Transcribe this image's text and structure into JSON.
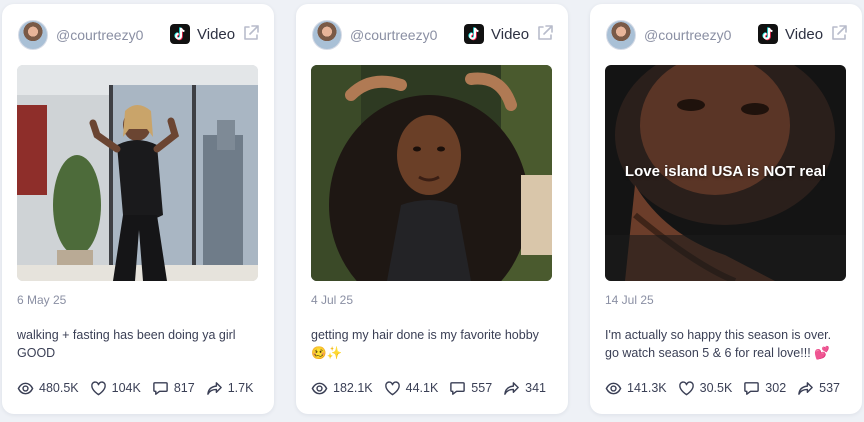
{
  "posts": [
    {
      "username": "@courtreezy0",
      "platform_label": "Video",
      "date": "6 May 25",
      "caption": "walking + fasting has been doing ya girl GOOD",
      "overlay_text": "",
      "stats": {
        "views": "480.5K",
        "likes": "104K",
        "comments": "817",
        "shares": "1.7K"
      }
    },
    {
      "username": "@courtreezy0",
      "platform_label": "Video",
      "date": "4 Jul 25",
      "caption": "getting my hair done is my favorite hobby 🥴✨",
      "overlay_text": "",
      "stats": {
        "views": "182.1K",
        "likes": "44.1K",
        "comments": "557",
        "shares": "341"
      }
    },
    {
      "username": "@courtreezy0",
      "platform_label": "Video",
      "date": "14 Jul 25",
      "caption": "I'm actually so happy this season is over. go watch season 5 & 6 for real love!!! 💕",
      "overlay_text": "Love island USA is NOT real",
      "stats": {
        "views": "141.3K",
        "likes": "30.5K",
        "comments": "302",
        "shares": "537"
      }
    }
  ],
  "icons": {
    "views": "eye-icon",
    "likes": "heart-icon",
    "comments": "comment-icon",
    "shares": "share-icon",
    "platform": "tiktok-icon",
    "open": "external-link-icon"
  },
  "colors": {
    "background": "#eef1f6",
    "card": "#ffffff",
    "muted_text": "#8a8fa3",
    "body_text": "#3a3f55"
  }
}
